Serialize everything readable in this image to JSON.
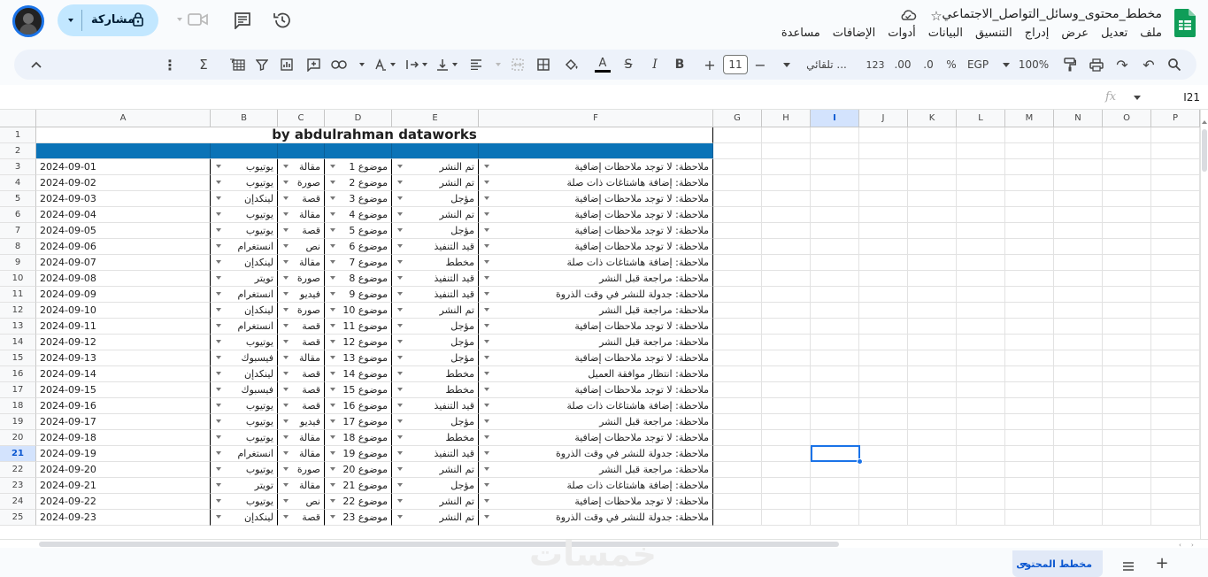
{
  "app": {
    "doc_title": "مخطط_محتوى_وسائل_التواصل_الاجتماعي",
    "share_label": "مشاركة",
    "menu": [
      "ملف",
      "تعديل",
      "عرض",
      "إدراج",
      "التنسيق",
      "البيانات",
      "أدوات",
      "الإضافات",
      "مساعدة"
    ]
  },
  "toolbar": {
    "zoom": "100%",
    "currency": "EGP",
    "percent": "%",
    "dec_dec": ".0",
    "dec_inc": ".00",
    "num_format": "123",
    "font": "تلقائي ...",
    "font_size": "11"
  },
  "formula": {
    "cell_ref": "I21",
    "fx": "fx"
  },
  "grid": {
    "title": "by abdulrahman dataworks",
    "columns": [
      "A",
      "B",
      "C",
      "D",
      "E",
      "F",
      "G",
      "H",
      "I",
      "J",
      "K",
      "L",
      "M",
      "N",
      "O",
      "P"
    ],
    "row_numbers": [
      "1",
      "2",
      "3",
      "4",
      "5",
      "6",
      "7",
      "8",
      "9",
      "10",
      "11",
      "12",
      "13",
      "14",
      "15",
      "16",
      "17",
      "18",
      "19",
      "20",
      "21",
      "22",
      "23",
      "24",
      "25"
    ],
    "rows": [
      {
        "date": "2024-09-01",
        "platform": "يوتيوب",
        "type": "مقالة",
        "topic": "موضوع 1",
        "status": "تم النشر",
        "note": "ملاحظة: لا توجد ملاحظات إضافية"
      },
      {
        "date": "2024-09-02",
        "platform": "يوتيوب",
        "type": "صورة",
        "topic": "موضوع 2",
        "status": "تم النشر",
        "note": "ملاحظة: إضافة هاشتاغات ذات صلة"
      },
      {
        "date": "2024-09-03",
        "platform": "لينكدإن",
        "type": "قصة",
        "topic": "موضوع 3",
        "status": "مؤجل",
        "note": "ملاحظة: لا توجد ملاحظات إضافية"
      },
      {
        "date": "2024-09-04",
        "platform": "يوتيوب",
        "type": "مقالة",
        "topic": "موضوع 4",
        "status": "تم النشر",
        "note": "ملاحظة: لا توجد ملاحظات إضافية"
      },
      {
        "date": "2024-09-05",
        "platform": "يوتيوب",
        "type": "قصة",
        "topic": "موضوع 5",
        "status": "مؤجل",
        "note": "ملاحظة: لا توجد ملاحظات إضافية"
      },
      {
        "date": "2024-09-06",
        "platform": "انستغرام",
        "type": "نص",
        "topic": "موضوع 6",
        "status": "قيد التنفيذ",
        "note": "ملاحظة: لا توجد ملاحظات إضافية"
      },
      {
        "date": "2024-09-07",
        "platform": "لينكدإن",
        "type": "مقالة",
        "topic": "موضوع 7",
        "status": "مخطط",
        "note": "ملاحظة: إضافة هاشتاغات ذات صلة"
      },
      {
        "date": "2024-09-08",
        "platform": "تويتر",
        "type": "صورة",
        "topic": "موضوع 8",
        "status": "قيد التنفيذ",
        "note": "ملاحظة: مراجعة قبل النشر"
      },
      {
        "date": "2024-09-09",
        "platform": "انستغرام",
        "type": "فيديو",
        "topic": "موضوع 9",
        "status": "قيد التنفيذ",
        "note": "ملاحظة: جدولة للنشر في وقت الذروة"
      },
      {
        "date": "2024-09-10",
        "platform": "لينكدإن",
        "type": "صورة",
        "topic": "موضوع 10",
        "status": "تم النشر",
        "note": "ملاحظة: مراجعة قبل النشر"
      },
      {
        "date": "2024-09-11",
        "platform": "انستغرام",
        "type": "قصة",
        "topic": "موضوع 11",
        "status": "مؤجل",
        "note": "ملاحظة: لا توجد ملاحظات إضافية"
      },
      {
        "date": "2024-09-12",
        "platform": "يوتيوب",
        "type": "قصة",
        "topic": "موضوع 12",
        "status": "مؤجل",
        "note": "ملاحظة: مراجعة قبل النشر"
      },
      {
        "date": "2024-09-13",
        "platform": "فيسبوك",
        "type": "مقالة",
        "topic": "موضوع 13",
        "status": "مؤجل",
        "note": "ملاحظة: لا توجد ملاحظات إضافية"
      },
      {
        "date": "2024-09-14",
        "platform": "لينكدإن",
        "type": "قصة",
        "topic": "موضوع 14",
        "status": "مخطط",
        "note": "ملاحظة: انتظار موافقة العميل"
      },
      {
        "date": "2024-09-15",
        "platform": "فيسبوك",
        "type": "قصة",
        "topic": "موضوع 15",
        "status": "مخطط",
        "note": "ملاحظة: لا توجد ملاحظات إضافية"
      },
      {
        "date": "2024-09-16",
        "platform": "يوتيوب",
        "type": "قصة",
        "topic": "موضوع 16",
        "status": "قيد التنفيذ",
        "note": "ملاحظة: إضافة هاشتاغات ذات صلة"
      },
      {
        "date": "2024-09-17",
        "platform": "يوتيوب",
        "type": "فيديو",
        "topic": "موضوع 17",
        "status": "مؤجل",
        "note": "ملاحظة: مراجعة قبل النشر"
      },
      {
        "date": "2024-09-18",
        "platform": "يوتيوب",
        "type": "مقالة",
        "topic": "موضوع 18",
        "status": "مخطط",
        "note": "ملاحظة: لا توجد ملاحظات إضافية"
      },
      {
        "date": "2024-09-19",
        "platform": "انستغرام",
        "type": "مقالة",
        "topic": "موضوع 19",
        "status": "قيد التنفيذ",
        "note": "ملاحظة: جدولة للنشر في وقت الذروة"
      },
      {
        "date": "2024-09-20",
        "platform": "يوتيوب",
        "type": "صورة",
        "topic": "موضوع 20",
        "status": "تم النشر",
        "note": "ملاحظة: مراجعة قبل النشر"
      },
      {
        "date": "2024-09-21",
        "platform": "تويتر",
        "type": "مقالة",
        "topic": "موضوع 21",
        "status": "مؤجل",
        "note": "ملاحظة: إضافة هاشتاغات ذات صلة"
      },
      {
        "date": "2024-09-22",
        "platform": "يوتيوب",
        "type": "نص",
        "topic": "موضوع 22",
        "status": "تم النشر",
        "note": "ملاحظة: لا توجد ملاحظات إضافية"
      },
      {
        "date": "2024-09-23",
        "platform": "لينكدإن",
        "type": "قصة",
        "topic": "موضوع 23",
        "status": "تم النشر",
        "note": "ملاحظة: جدولة للنشر في وقت الذروة"
      }
    ]
  },
  "sheets": {
    "active": "مخطط المحتوى"
  },
  "watermark": "خمسات",
  "colors": {
    "header_blue": "#0b73b7",
    "accent": "#0b57d0",
    "share_bg": "#c2e7ff",
    "selection": "#1a73e8"
  }
}
